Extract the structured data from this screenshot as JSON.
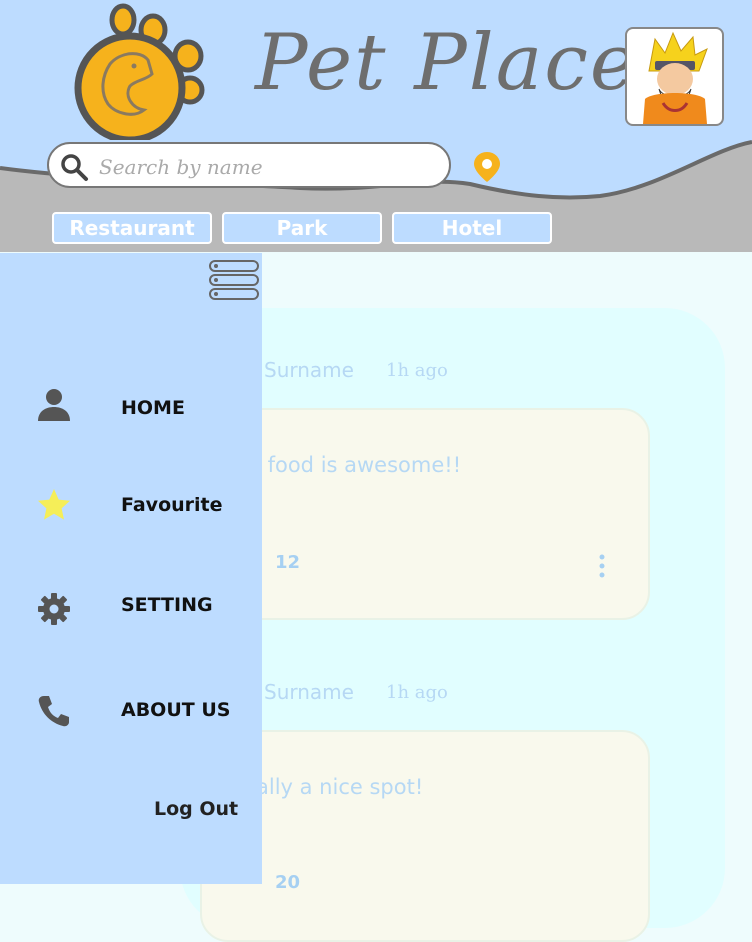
{
  "app": {
    "title": "Pet Places"
  },
  "search": {
    "placeholder": "Search by name"
  },
  "categories": [
    {
      "label": "Restaurant"
    },
    {
      "label": "Park"
    },
    {
      "label": "Hotel"
    }
  ],
  "drawer": {
    "items": [
      {
        "label": "HOME",
        "icon": "person-icon"
      },
      {
        "label": "Favourite",
        "icon": "star-icon"
      },
      {
        "label": "SETTING",
        "icon": "gear-icon"
      },
      {
        "label": "ABOUT US",
        "icon": "phone-icon"
      }
    ],
    "logout_label": "Log Out"
  },
  "posts": [
    {
      "author": "Surname",
      "time": "1h ago",
      "text": "e food is awesome!!",
      "count": "12"
    },
    {
      "author": "Surname",
      "time": "1h ago",
      "text": "ally a nice spot!",
      "count": "20"
    }
  ],
  "colors": {
    "header_bg": "#bddcff",
    "drawer_bg": "#bddcff",
    "band_grey": "#b9b9b9",
    "content_bg": "#e1feff",
    "bubble_bg": "#f9f9ed",
    "accent_orange": "#f6b21c",
    "star_yellow": "#f5ee58"
  }
}
